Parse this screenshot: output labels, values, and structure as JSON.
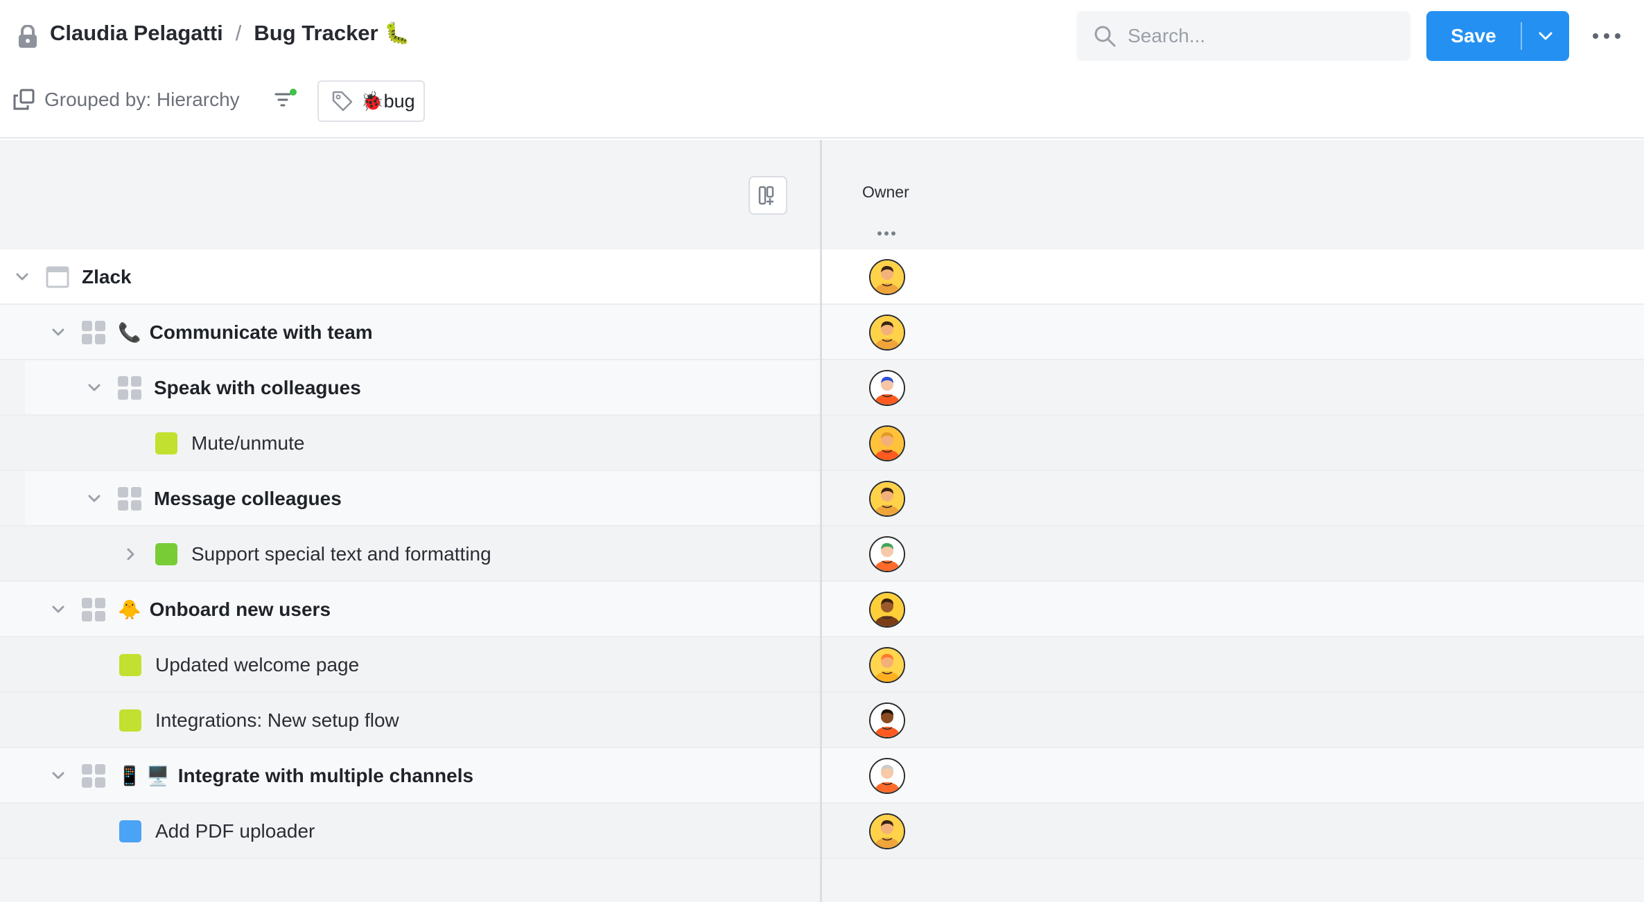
{
  "header": {
    "owner": "Claudia Pelagatti",
    "separator": "/",
    "project": "Bug Tracker",
    "project_emoji": "🐛"
  },
  "search": {
    "placeholder": "Search..."
  },
  "save": {
    "label": "Save"
  },
  "toolbar": {
    "grouped_by": "Grouped by: Hierarchy",
    "tag_emoji": "🐞",
    "tag_label": "bug"
  },
  "columns": {
    "owner": "Owner"
  },
  "colors": {
    "accent": "#2491f2",
    "status_lime": "#c2e02f",
    "status_green": "#78cc36",
    "status_blue": "#4ba3f5",
    "filter_dot": "#3ec24a"
  },
  "rows": [
    {
      "label": "Zlack",
      "emoji": "",
      "level": 0,
      "kind": "project",
      "toggle": "expanded",
      "avatar": "a1"
    },
    {
      "label": "Communicate with team",
      "emoji": "📞",
      "level": 1,
      "kind": "group",
      "toggle": "expanded",
      "avatar": "a1"
    },
    {
      "label": "Speak with colleagues",
      "emoji": "",
      "level": 2,
      "kind": "group",
      "toggle": "expanded",
      "avatar": "a2"
    },
    {
      "label": "Mute/unmute",
      "emoji": "",
      "level": 3,
      "kind": "task",
      "status": "lime",
      "toggle": "none",
      "avatar": "a3"
    },
    {
      "label": "Message colleagues",
      "emoji": "",
      "level": 2,
      "kind": "group",
      "toggle": "expanded",
      "avatar": "a1"
    },
    {
      "label": "Support special text and formatting",
      "emoji": "",
      "level": 3,
      "kind": "task",
      "status": "green",
      "toggle": "collapsed",
      "avatar": "a4"
    },
    {
      "label": "Onboard new users",
      "emoji": "🐥",
      "level": 1,
      "kind": "group",
      "toggle": "expanded",
      "avatar": "a5"
    },
    {
      "label": "Updated welcome page",
      "emoji": "",
      "level": 2,
      "kind": "task",
      "status": "lime",
      "toggle": "none",
      "avatar": "a6"
    },
    {
      "label": "Integrations: New setup flow",
      "emoji": "",
      "level": 2,
      "kind": "task",
      "status": "lime",
      "toggle": "none",
      "avatar": "a7"
    },
    {
      "label": "Integrate with multiple channels",
      "emoji": "📱 🖥️",
      "level": 1,
      "kind": "group",
      "toggle": "expanded",
      "avatar": "a8"
    },
    {
      "label": "Add PDF uploader",
      "emoji": "",
      "level": 2,
      "kind": "task",
      "status": "blue",
      "toggle": "none",
      "avatar": "a1"
    }
  ]
}
